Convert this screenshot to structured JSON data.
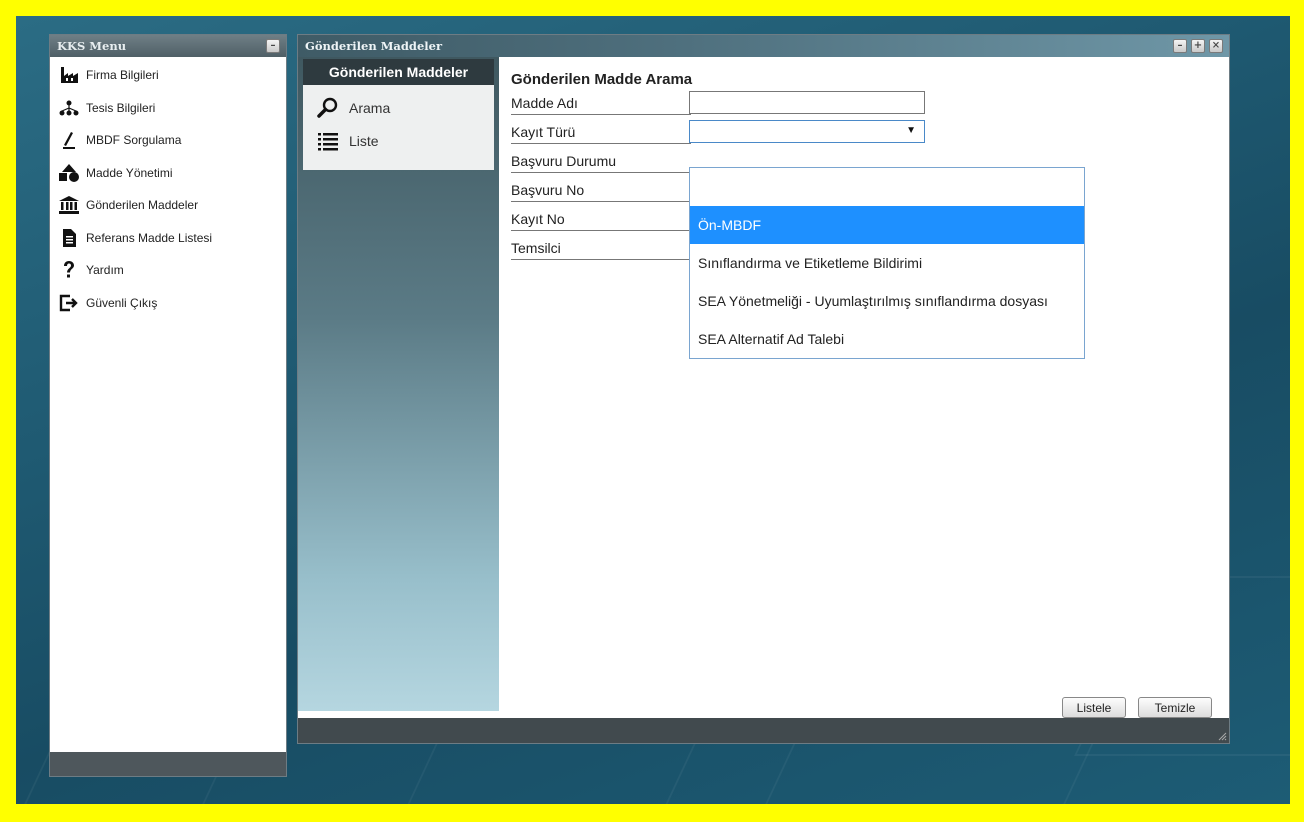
{
  "menu": {
    "title": "KKS Menu",
    "items": [
      {
        "label": "Firma Bilgileri",
        "icon": "factory-icon"
      },
      {
        "label": "Tesis Bilgileri",
        "icon": "network-icon"
      },
      {
        "label": "MBDF Sorgulama",
        "icon": "pen-icon"
      },
      {
        "label": "Madde Yönetimi",
        "icon": "shapes-icon"
      },
      {
        "label": "Gönderilen Maddeler",
        "icon": "bank-icon"
      },
      {
        "label": "Referans Madde Listesi",
        "icon": "document-icon"
      },
      {
        "label": "Yardım",
        "icon": "question-icon"
      },
      {
        "label": "Güvenli Çıkış",
        "icon": "logout-icon"
      }
    ]
  },
  "window": {
    "title": "Gönderilen Maddeler",
    "nav_header": "Gönderilen Maddeler",
    "nav": [
      {
        "label": "Arama",
        "icon": "search-icon"
      },
      {
        "label": "Liste",
        "icon": "list-icon"
      }
    ]
  },
  "form": {
    "title": "Gönderilen Madde Arama",
    "fields": {
      "madde_adi": {
        "label": "Madde Adı",
        "value": ""
      },
      "kayit_turu": {
        "label": "Kayıt Türü",
        "value": ""
      },
      "basvuru_durumu": {
        "label": "Başvuru Durumu"
      },
      "basvuru_no": {
        "label": "Başvuru No"
      },
      "kayit_no": {
        "label": "Kayıt No"
      },
      "temsilci": {
        "label": "Temsilci"
      }
    },
    "dropdown_options": [
      "",
      "Ön-MBDF",
      "Sınıflandırma ve Etiketleme Bildirimi",
      "SEA Yönetmeliği - Uyumlaştırılmış sınıflandırma dosyası",
      "SEA Alternatif Ad Talebi"
    ],
    "dropdown_highlighted": "Ön-MBDF",
    "buttons": {
      "listele": "Listele",
      "temizle": "Temizle"
    }
  },
  "colors": {
    "highlight": "#1e90ff",
    "border_yellow": "#ffff00",
    "background": "#1f5a72"
  }
}
